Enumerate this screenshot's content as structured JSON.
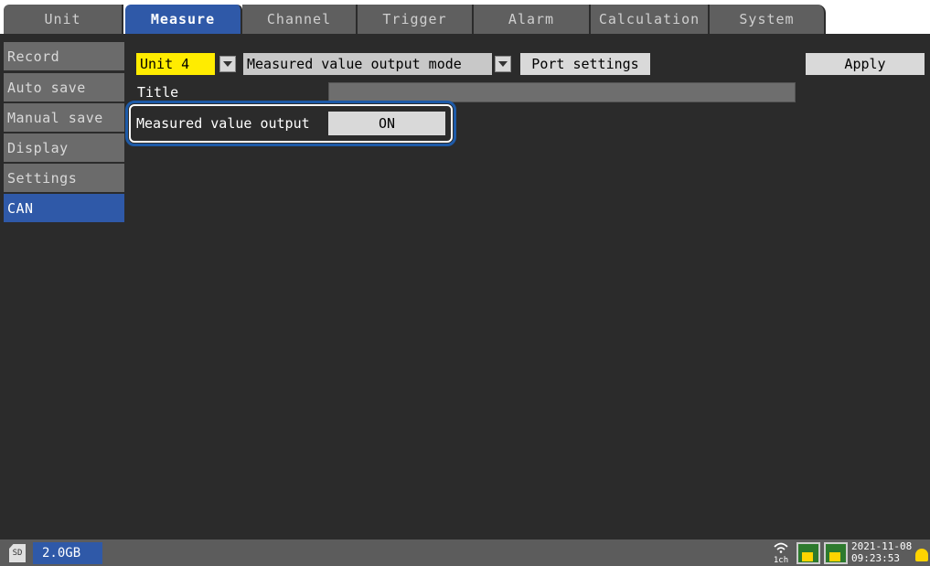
{
  "tabs": [
    {
      "label": "Unit"
    },
    {
      "label": "Measure",
      "active": true
    },
    {
      "label": "Channel"
    },
    {
      "label": "Trigger"
    },
    {
      "label": "Alarm"
    },
    {
      "label": "Calculation"
    },
    {
      "label": "System"
    }
  ],
  "sidebar": {
    "items": [
      {
        "label": "Record"
      },
      {
        "label": "Auto save"
      },
      {
        "label": "Manual save"
      },
      {
        "label": "Display"
      },
      {
        "label": "Settings"
      },
      {
        "label": "CAN",
        "active": true
      }
    ]
  },
  "toolbar": {
    "unit_value": "Unit 4",
    "mode_value": "Measured value output mode",
    "port_settings_label": "Port settings",
    "apply_label": "Apply"
  },
  "form": {
    "title_label": "Title",
    "title_value": "",
    "measured_value_output_label": "Measured value output",
    "measured_value_output_value": "ON"
  },
  "status": {
    "storage": "2.0GB",
    "channel_label": "1ch",
    "date": "2021-11-08",
    "time": "09:23:53",
    "sd_label": "SD"
  },
  "colors": {
    "accent": "#2f59a8",
    "highlight": "#ffec00",
    "panel": "#2b2b2b"
  }
}
